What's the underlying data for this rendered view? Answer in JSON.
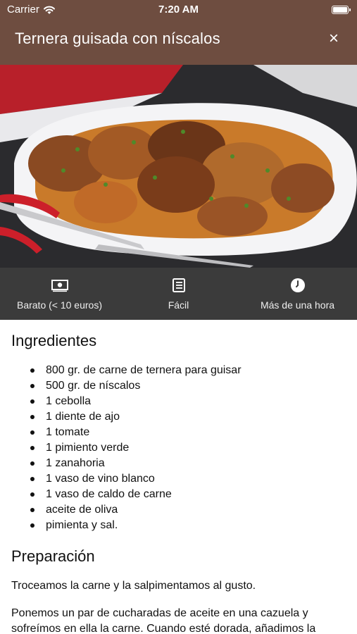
{
  "status_bar": {
    "carrier": "Carrier",
    "time": "7:20 AM"
  },
  "header": {
    "title": "Ternera guisada con níscalos",
    "close_label": "×"
  },
  "recipe_meta": [
    {
      "icon": "money-icon",
      "label": "Barato (< 10 euros)"
    },
    {
      "icon": "book-icon",
      "label": "Fácil"
    },
    {
      "icon": "clock-icon",
      "label": "Más de una hora"
    }
  ],
  "ingredients": {
    "title": "Ingredientes",
    "items": [
      "800 gr. de carne de ternera para guisar",
      "500 gr. de níscalos",
      "1 cebolla",
      "1 diente de ajo",
      "1 tomate",
      "1 pimiento verde",
      "1 zanahoria",
      "1 vaso de vino blanco",
      "1 vaso de caldo de carne",
      "aceite de oliva",
      "pimienta y sal."
    ]
  },
  "preparation": {
    "title": "Preparación",
    "paragraphs": [
      "Troceamos la carne y la salpimentamos al gusto.",
      "Ponemos un par de cucharadas de aceite en una cazuela y sofreímos en ella la carne. Cuando esté dorada, añadimos la"
    ]
  },
  "colors": {
    "header_bg": "#6e4d40",
    "meta_bg": "#3b3b3b"
  }
}
